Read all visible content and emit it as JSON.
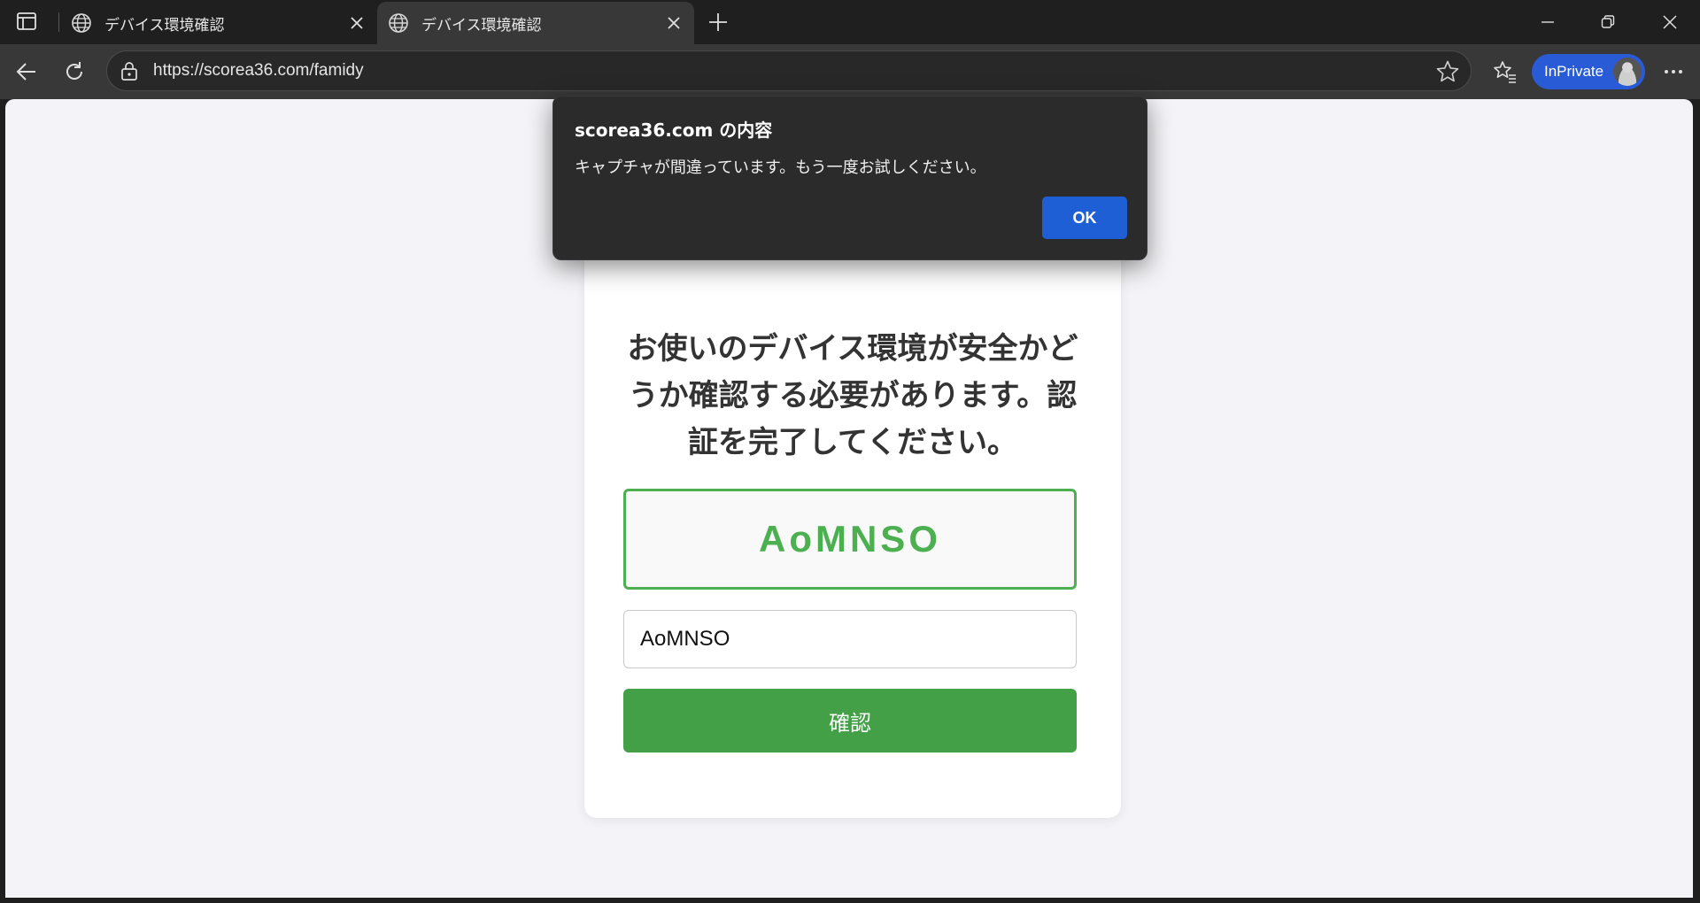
{
  "browser": {
    "tabs": [
      {
        "title": "デバイス環境確認",
        "active": false
      },
      {
        "title": "デバイス環境確認",
        "active": true
      }
    ],
    "address": {
      "url": "https://scorea36.com/famidy"
    },
    "profile": {
      "label": "InPrivate"
    },
    "icons": {
      "tab_actions": "tab-actions-icon",
      "globe": "globe-icon",
      "close": "close-icon",
      "new_tab": "plus-icon",
      "minimize": "minimize-icon",
      "restore": "restore-icon",
      "window_close": "close-icon",
      "back": "back-arrow-icon",
      "reload": "reload-icon",
      "lock": "lock-icon",
      "favorite": "star-icon",
      "favorites": "favorites-icon",
      "menu": "more-icon"
    }
  },
  "page": {
    "heading": "お使いのデバイス環境が安全かどうか確認する必要があります。認証を完了してください。",
    "captcha_code": "AoMNSO",
    "captcha_input_value": "AoMNSO",
    "confirm_button": "確認"
  },
  "dialog": {
    "title": "scorea36.com の内容",
    "message": "キャプチャが間違っています。もう一度お試しください。",
    "ok_button": "OK"
  },
  "colors": {
    "accent_green": "#43a047",
    "captcha_green": "#4caf50",
    "inprivate_blue": "#2a5bd7",
    "dialog_button_blue": "#1f5fd6"
  }
}
